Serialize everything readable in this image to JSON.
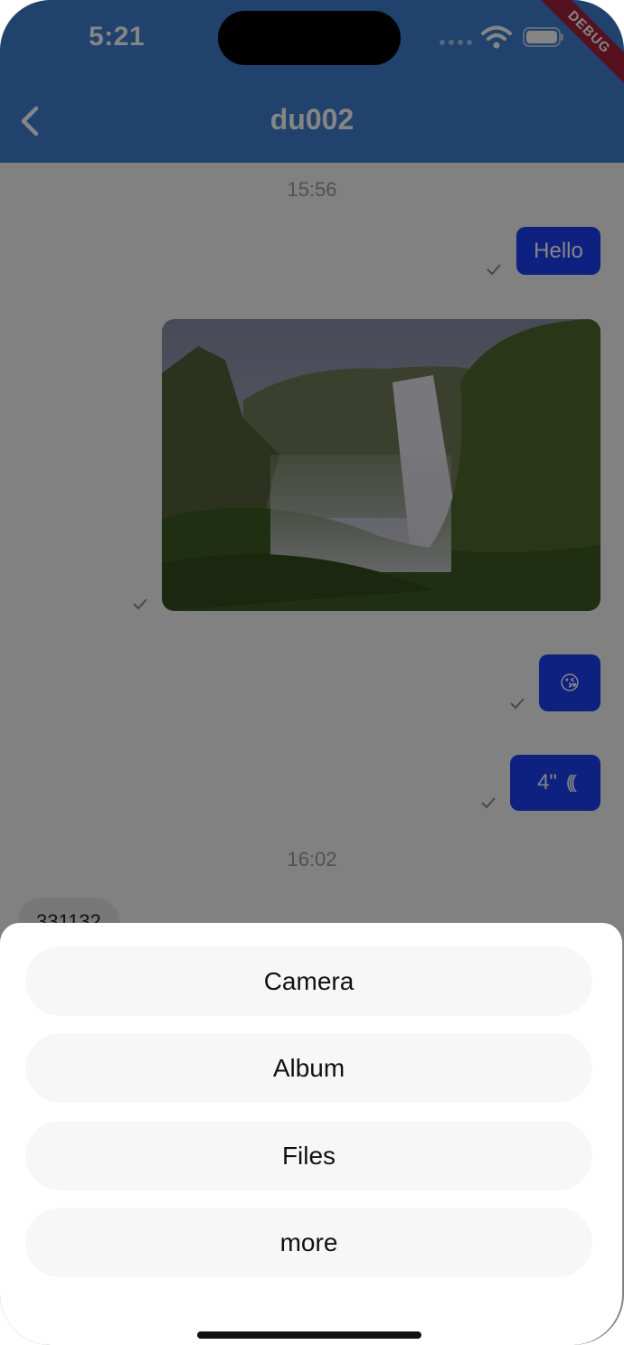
{
  "status_bar": {
    "time": "5:21",
    "debug_label": "DEBUG"
  },
  "header": {
    "title": "du002",
    "back_icon": "chevron-left-icon"
  },
  "chat": {
    "timestamp_1": "15:56",
    "msg_hello": "Hello",
    "msg_emoji": "😘",
    "msg_voice_duration": "4\"",
    "msg_voice_icon": "(((",
    "timestamp_2": "16:02",
    "incoming_msg": "331132"
  },
  "sheet": {
    "options": [
      "Camera",
      "Album",
      "Files",
      "more"
    ]
  },
  "colors": {
    "app_bar": "#3f7fd1",
    "bubble": "#1c3ff5",
    "debug_ribbon": "#a3223f"
  }
}
